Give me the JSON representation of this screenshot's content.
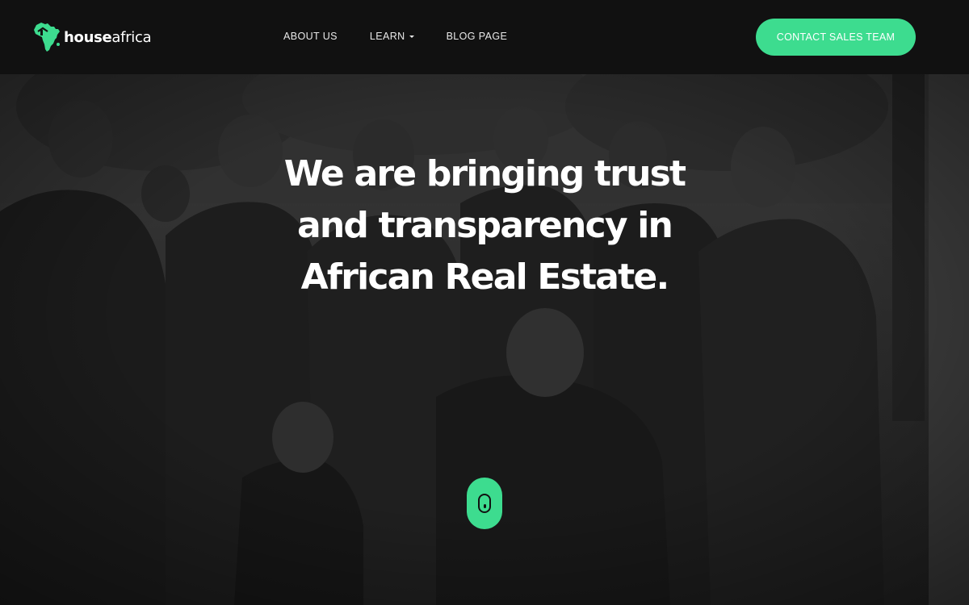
{
  "brand": {
    "name_bold": "house",
    "name_light": "africa",
    "logo_icon": "africa-map-icon",
    "accent_color": "#3ddc8f"
  },
  "nav": {
    "items": [
      {
        "label": "ABOUT US"
      },
      {
        "label": "LEARN",
        "has_dropdown": true
      },
      {
        "label": "BLOG PAGE"
      }
    ],
    "cta_label": "CONTACT SALES TEAM"
  },
  "hero": {
    "headline_lines": [
      "We are bringing trust",
      "and transparency in",
      "African Real Estate."
    ],
    "background": "team-group-photo-monochrome",
    "scroll_icon": "mouse-scroll-icon"
  }
}
